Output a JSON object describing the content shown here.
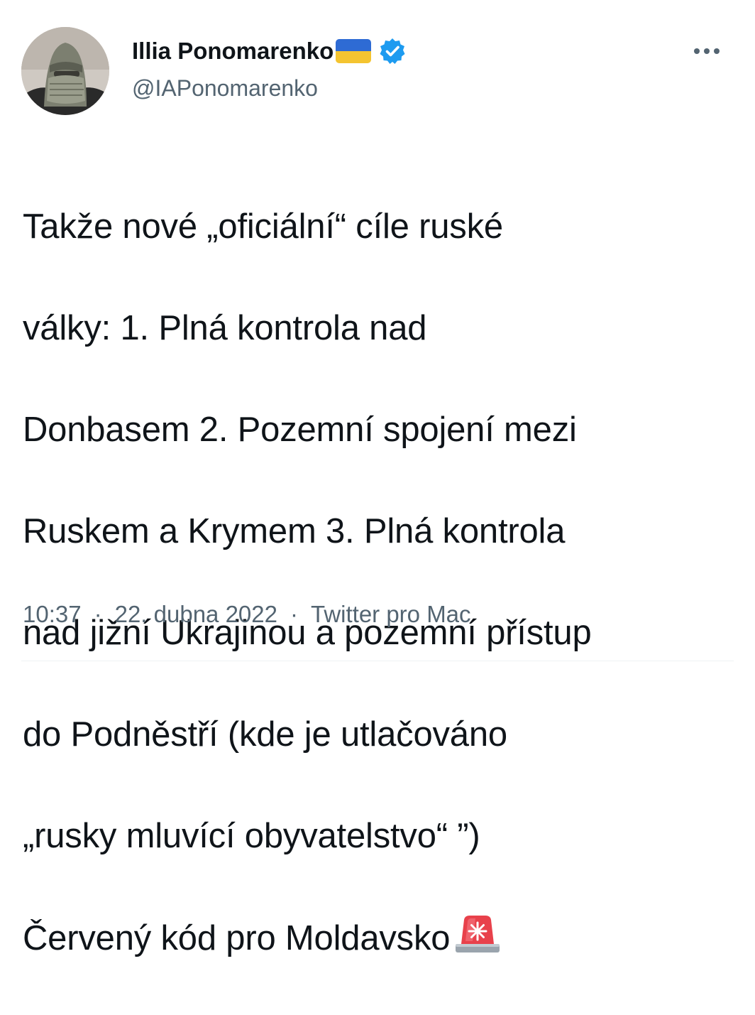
{
  "author": {
    "display_name": "Illia Ponomarenko",
    "handle": "@IAPonomarenko",
    "flag": "ukraine-flag",
    "verified": true
  },
  "tweet": {
    "lines": [
      "Takže nové „oficiální“ cíle ruské",
      "války: 1. Plná kontrola nad",
      "Donbasem 2. Pozemní spojení mezi",
      "Ruskem a Krymem 3. Plná kontrola",
      "nad jižní Ukrajinou a pozemní přístup",
      "do Podněstří (kde je utlačováno",
      "„rusky mluvící obyvatelstvo“ ”)",
      "Červený kód pro Moldavsko"
    ],
    "trailing_emoji": "police-car-light-emoji"
  },
  "meta": {
    "time": "10:37",
    "date": "22. dubna 2022",
    "separator": "·",
    "source": "Twitter pro Mac"
  },
  "colors": {
    "text": "#0f1419",
    "secondary": "#536471",
    "verified_blue": "#1d9bf0",
    "flag_blue": "#2e6bd4",
    "flag_yellow": "#f4c430",
    "siren_red": "#e8414b"
  }
}
